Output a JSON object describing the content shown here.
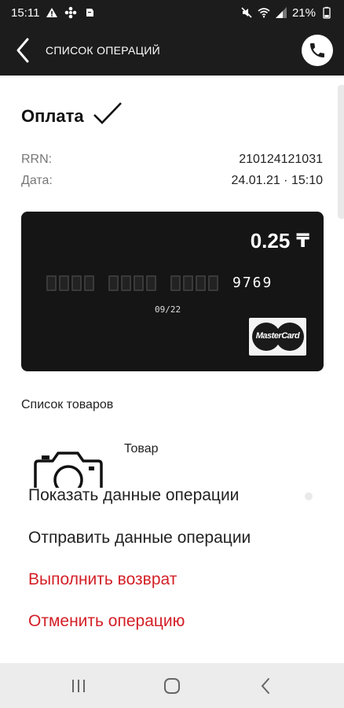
{
  "status_bar": {
    "time": "15:11",
    "battery": "21%",
    "left_icons": [
      "warning-icon",
      "pinwheel-icon",
      "notification-icon"
    ],
    "right_icons": [
      "mute-icon",
      "wifi-icon",
      "signal-icon",
      "battery-icon"
    ]
  },
  "app_bar": {
    "title": "СПИСОК ОПЕРАЦИЙ",
    "back_icon": "chevron-left-icon",
    "call_icon": "phone-icon"
  },
  "operation": {
    "title": "Оплата",
    "status_icon": "checkmark-icon",
    "rrn_label": "RRN:",
    "rrn_value": "210124121031",
    "date_label": "Дата:",
    "date_value": "24.01.21 · 15:10"
  },
  "card": {
    "amount": "0.25",
    "currency_symbol": "₸",
    "last4": "9769",
    "expiry": "09/22",
    "brand": "MasterCard"
  },
  "goods": {
    "section_title": "Список товаров",
    "items": [
      {
        "name": "Товар",
        "icon": "camera-icon"
      }
    ]
  },
  "menu": {
    "show_details": "Показать данные операции",
    "send_details": "Отправить данные операции",
    "refund": "Выполнить возврат",
    "cancel": "Отменить операцию"
  },
  "colors": {
    "bar_bg": "#1c1c1c",
    "danger": "#d32027",
    "card_bg": "#151515",
    "nav_bg": "#ececec"
  }
}
